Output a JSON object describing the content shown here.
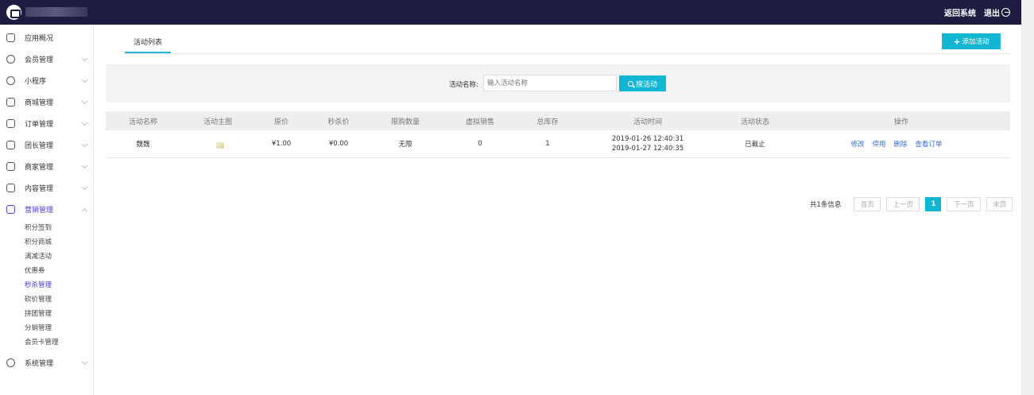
{
  "header": {
    "return_label": "返回系统",
    "logout_label": "退出"
  },
  "sidebar": {
    "items": [
      {
        "label": "应用概况"
      },
      {
        "label": "会员管理"
      },
      {
        "label": "小程序"
      },
      {
        "label": "商城管理"
      },
      {
        "label": "订单管理"
      },
      {
        "label": "团长管理"
      },
      {
        "label": "商家管理"
      },
      {
        "label": "内容管理"
      },
      {
        "label": "营销管理"
      },
      {
        "label": "系统管理"
      }
    ],
    "sub_items": [
      "积分签到",
      "积分商城",
      "满减活动",
      "优惠券",
      "秒杀管理",
      "砍价管理",
      "拼团管理",
      "分销管理",
      "会员卡管理"
    ]
  },
  "main": {
    "tab_label": "活动列表",
    "add_button": "添加活动",
    "search": {
      "label": "活动名称:",
      "placeholder": "输入活动名称",
      "button": "搜活动"
    },
    "table": {
      "headers": [
        "活动名称",
        "活动主图",
        "原价",
        "秒杀价",
        "限购数量",
        "虚拟销售",
        "总库存",
        "活动时间",
        "活动状态",
        "操作"
      ],
      "rows": [
        {
          "name": "魏魏",
          "price": "¥1.00",
          "seckill_price": "¥0.00",
          "limit": "无限",
          "virtual_sales": "0",
          "stock": "1",
          "time_start": "2019-01-26 12:40:31",
          "time_end": "2019-01-27 12:40:35",
          "status": "已截止",
          "ops": [
            "修改",
            "停用",
            "删除",
            "查看订单"
          ]
        }
      ]
    },
    "pagination": {
      "info": "共1条信息",
      "first": "首页",
      "prev": "上一页",
      "current": "1",
      "next": "下一页",
      "last": "末页"
    }
  }
}
